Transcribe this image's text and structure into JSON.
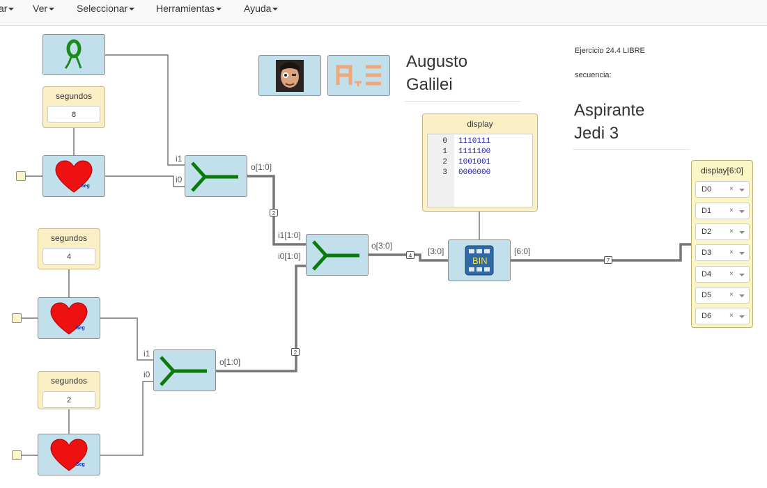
{
  "menubar": {
    "items": [
      "ar",
      "Ver",
      "Seleccionar",
      "Herramientas",
      "Ayuda"
    ]
  },
  "header": {
    "author_line1": "Augusto",
    "author_line2": "Galilei",
    "exercise": "Ejercicio 24.4 LIBRE",
    "sequence_label": "secuencia:",
    "project_line1": "Aspirante",
    "project_line2": "Jedi 3"
  },
  "params": {
    "p1": {
      "title": "segundos",
      "value": "8"
    },
    "p2": {
      "title": "segundos",
      "value": "4"
    },
    "p3": {
      "title": "segundos",
      "value": "2"
    }
  },
  "heart_label": "Seg",
  "bin_label": "BIN",
  "port_labels": {
    "j1_i1": "i1",
    "j1_i0": "i0",
    "j1_o": "o[1:0]",
    "j2_i1": "i1[1:0]",
    "j2_i0": "i0[1:0]",
    "j2_o": "o[3:0]",
    "j3_i1": "i1",
    "j3_i0": "i0",
    "j3_o": "o[1:0]",
    "bin_in": "[3:0]",
    "bin_out": "[6:0]"
  },
  "bus_widths": {
    "w1": "2",
    "w2": "2",
    "w3": "4",
    "w4": "7"
  },
  "display_memory": {
    "title": "display",
    "rows": [
      {
        "index": "0",
        "value": "1110111"
      },
      {
        "index": "1",
        "value": "1111100"
      },
      {
        "index": "2",
        "value": "1001001"
      },
      {
        "index": "3",
        "value": "0000000"
      }
    ]
  },
  "outputs": {
    "title": "display[6:0]",
    "items": [
      "D0",
      "D1",
      "D2",
      "D3",
      "D4",
      "D5",
      "D6"
    ],
    "close_glyph": "×"
  },
  "colors": {
    "block": "#c2e0ec",
    "param": "#fbefc6",
    "output_panel": "#fbf6c6",
    "wire": "#777777",
    "heart": "#ee1111",
    "joiner": "#0a7a0a"
  }
}
